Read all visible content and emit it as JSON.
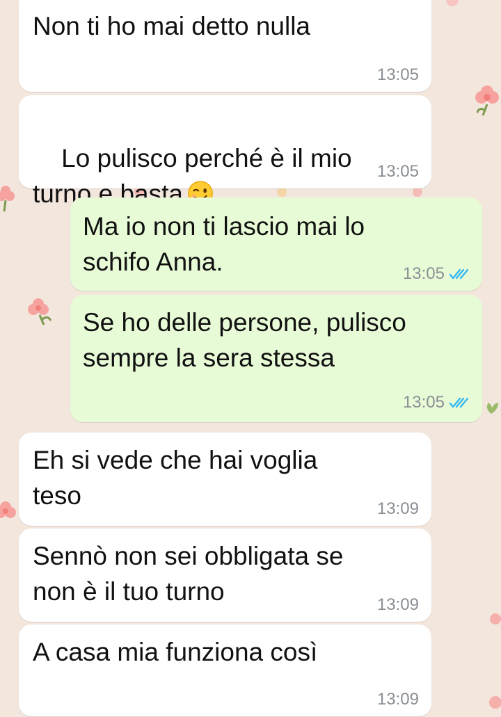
{
  "colors": {
    "wallpaper": "#f2e6dd",
    "incoming_bubble": "#ffffff",
    "outgoing_bubble": "#e8fbd7",
    "timestamp": "#8a8f94",
    "read_ticks": "#34b7f1"
  },
  "messages": [
    {
      "direction": "incoming",
      "text": "Non ti ho mai detto nulla",
      "time": "13:05"
    },
    {
      "direction": "incoming",
      "text": "Lo pulisco perché è il mio\nturno e basta",
      "emoji": "winking-face-icon",
      "time": "13:05"
    },
    {
      "direction": "outgoing",
      "text": "Ma io non ti lascio mai lo\nschifo Anna.",
      "time": "13:05",
      "status": "read-double-check-icon"
    },
    {
      "direction": "outgoing",
      "text": "Se ho delle persone, pulisco\nsempre la sera stessa",
      "time": "13:05",
      "status": "read-double-check-icon"
    },
    {
      "direction": "incoming",
      "text": "Eh si vede che hai voglia\nteso",
      "time": "13:09"
    },
    {
      "direction": "incoming",
      "text": "Sennò non sei obbligata se\nnon è il tuo turno",
      "time": "13:09"
    },
    {
      "direction": "incoming",
      "text": "A casa mia funziona così",
      "time": "13:09"
    }
  ]
}
